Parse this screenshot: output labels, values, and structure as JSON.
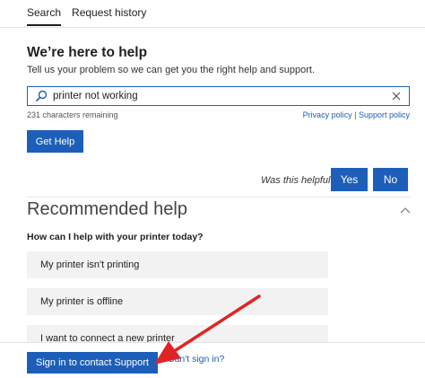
{
  "tabs": [
    {
      "label": "Search",
      "active": true
    },
    {
      "label": "Request history",
      "active": false
    }
  ],
  "help": {
    "title": "We’re here to help",
    "subtitle": "Tell us your problem so we can get you the right help and support."
  },
  "search": {
    "value": "printer not working",
    "chars_remaining": "231 characters remaining",
    "privacy_label": "Privacy policy",
    "support_policy_label": "Support policy",
    "separator": "|"
  },
  "buttons": {
    "get_help": "Get Help",
    "yes": "Yes",
    "no": "No",
    "sign_in": "Sign in to contact Support",
    "cant_sign_in": "Can't sign in?"
  },
  "feedback": {
    "question": "Was this helpful?"
  },
  "recommended": {
    "heading": "Recommended help",
    "question": "How can I help with your printer today?",
    "options": [
      "My printer isn't printing",
      "My printer is offline",
      "I want to connect a new printer"
    ]
  },
  "colors": {
    "accent": "#1d5fb8",
    "annotation_arrow": "#e02424",
    "option_bg": "#f2f2f2"
  }
}
